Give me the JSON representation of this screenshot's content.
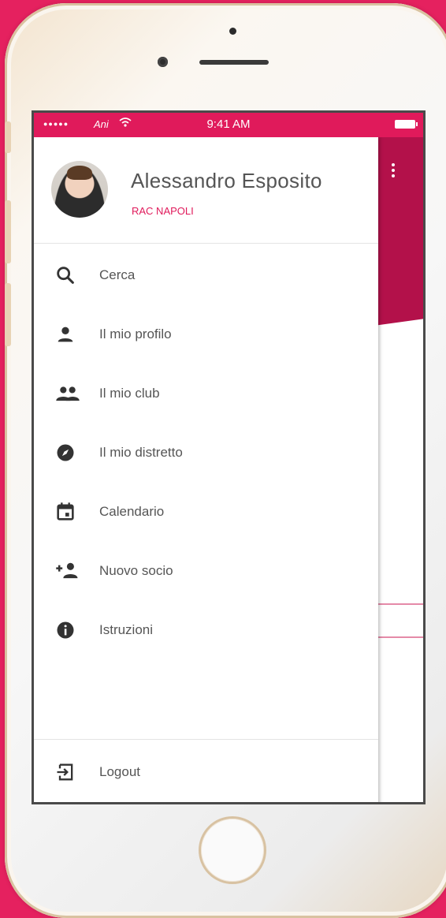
{
  "status_bar": {
    "carrier": "Ani",
    "time": "9:41 AM"
  },
  "profile": {
    "name": "Alessandro Esposito",
    "club": "RAC NAPOLI"
  },
  "menu": {
    "items": [
      {
        "label": "Cerca",
        "icon": "search-icon"
      },
      {
        "label": "Il mio profilo",
        "icon": "person-icon"
      },
      {
        "label": "Il mio club",
        "icon": "group-icon"
      },
      {
        "label": "Il mio distretto",
        "icon": "compass-icon"
      },
      {
        "label": "Calendario",
        "icon": "calendar-icon"
      },
      {
        "label": "Nuovo socio",
        "icon": "add-person-icon"
      },
      {
        "label": "Istruzioni",
        "icon": "info-icon"
      }
    ],
    "logout_label": "Logout"
  },
  "colors": {
    "accent": "#e01a5b",
    "header_bg": "#b3114a",
    "page_bg": "#e5215f"
  }
}
